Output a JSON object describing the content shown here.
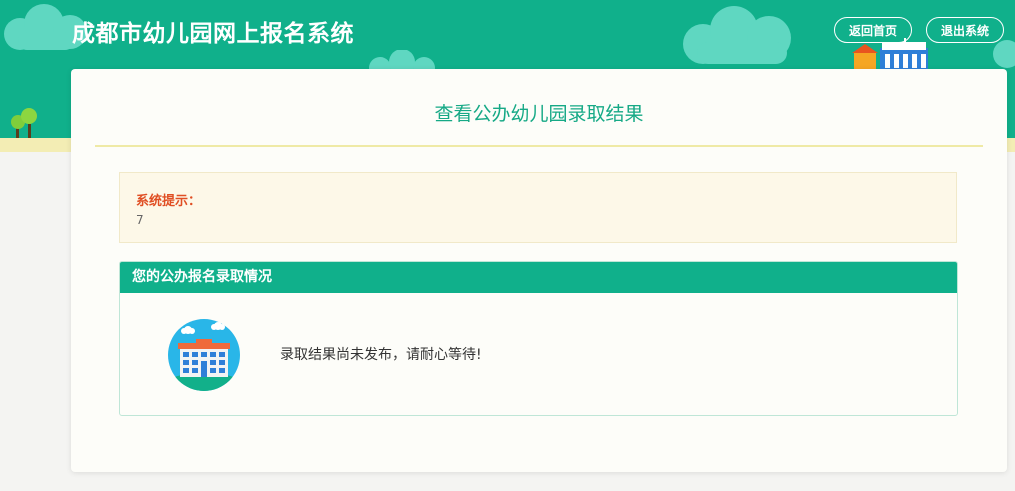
{
  "header": {
    "title": "成都市幼儿园网上报名系统",
    "buttons": {
      "home": "返回首页",
      "exit": "退出系统"
    }
  },
  "page": {
    "title": "查看公办幼儿园录取结果"
  },
  "notice": {
    "label": "系统提示：",
    "text": "7"
  },
  "result_panel": {
    "heading": "您的公办报名录取情况",
    "message": "录取结果尚未发布，请耐心等待!",
    "icon": "school-building-icon"
  },
  "colors": {
    "brand_green": "#10b08b",
    "cloud": "#5fd7c1",
    "ground": "#f3edb4",
    "notice_label": "#e04f24",
    "notice_bg": "#fdf8e8"
  }
}
